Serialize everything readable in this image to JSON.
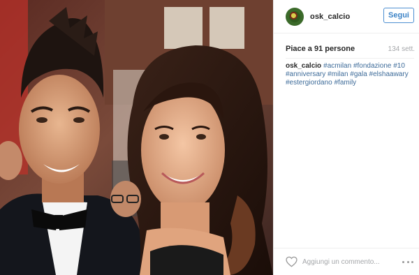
{
  "post": {
    "photo_alt": "",
    "author": {
      "username": "osk_calcio",
      "avatar_icon": "club-badge-avatar"
    },
    "follow_label": "Segui",
    "likes_text": "Piace a 91 persone",
    "time_text": "134 sett.",
    "caption": {
      "username": "osk_calcio",
      "hashtags": [
        "#acmilan",
        "#fondazione",
        "#10",
        "#anniversary",
        "#milan",
        "#gala",
        "#elshaawary",
        "#estergiordano",
        "#family"
      ]
    },
    "comment": {
      "placeholder": "Aggiungi un commento...",
      "value": ""
    },
    "icons": {
      "like": "heart-icon",
      "more": "more-options-icon"
    },
    "colors": {
      "follow_blue": "#3d84c7",
      "hashtag_blue": "#3d6b99",
      "muted_gray": "#a5a7aa",
      "divider": "#efefef"
    }
  }
}
